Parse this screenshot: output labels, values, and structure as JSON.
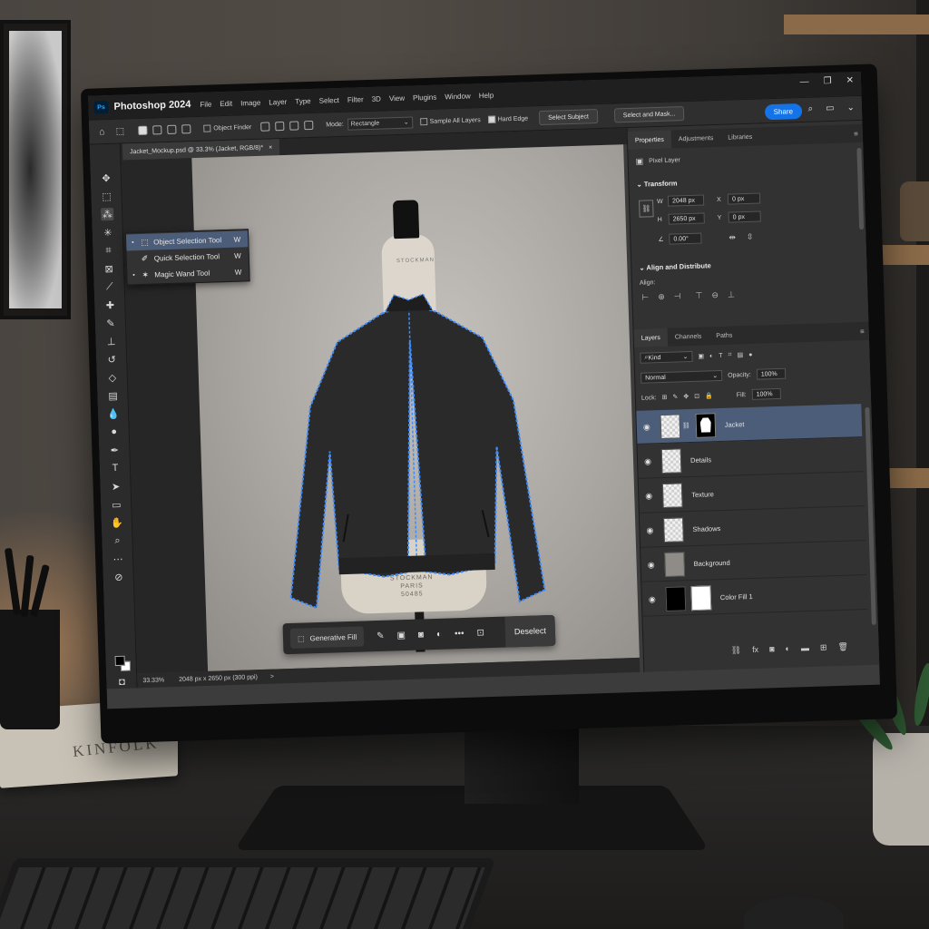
{
  "scene": {
    "book_title": "KINFOLK"
  },
  "titlebar": {
    "logo": "Ps",
    "app_name": "Photoshop 2024",
    "menu": [
      "File",
      "Edit",
      "Image",
      "Layer",
      "Type",
      "Select",
      "Filter",
      "3D",
      "View",
      "Plugins",
      "Window",
      "Help"
    ],
    "window_controls": [
      "—",
      "❐",
      "✕"
    ]
  },
  "options_bar": {
    "object_finder": "Object Finder",
    "mode_label": "Mode:",
    "mode_value": "Rectangle",
    "sample_all_layers": "Sample All Layers",
    "hard_edge": "Hard Edge",
    "select_subject": "Select Subject",
    "select_and_mask": "Select and Mask...",
    "share": "Share",
    "accent_color": "#1473e6"
  },
  "document_tab": {
    "title": "Jacket_Mockup.psd @ 33.3% (Jacket, RGB/8)*",
    "close": "×"
  },
  "tool_flyout": {
    "items": [
      {
        "label": "Object Selection Tool",
        "key": "W",
        "icon": "object-selection-icon",
        "selected": true
      },
      {
        "label": "Quick Selection Tool",
        "key": "W",
        "icon": "quick-selection-icon",
        "selected": false
      },
      {
        "label": "Magic Wand Tool",
        "key": "W",
        "icon": "magic-wand-icon",
        "selected": false
      }
    ]
  },
  "canvas": {
    "neck_label": "STOCKMAN",
    "form_label_1": "STOCKMAN",
    "form_label_2": "PARIS",
    "form_label_3": "50485"
  },
  "context_bar": {
    "generative_fill": "Generative Fill",
    "more": "•••",
    "deselect": "Deselect"
  },
  "status_bar": {
    "zoom": "33.33%",
    "doc_info": "2048 px x 2650 px (300 ppi)",
    "arrow": ">"
  },
  "properties_panel": {
    "tabs": [
      "Properties",
      "Adjustments",
      "Libraries"
    ],
    "layer_kind": "Pixel Layer",
    "transform_title": "Transform",
    "w_label": "W",
    "w_value": "2048 px",
    "h_label": "H",
    "h_value": "2650 px",
    "x_label": "X",
    "x_value": "0 px",
    "y_label": "Y",
    "y_value": "0 px",
    "angle_value": "0.00°",
    "align_title": "Align and Distribute",
    "align_label": "Align:"
  },
  "layers_panel": {
    "tabs": [
      "Layers",
      "Channels",
      "Paths"
    ],
    "filter_kind": "Kind",
    "blend_mode": "Normal",
    "opacity_label": "Opacity:",
    "opacity_value": "100%",
    "lock_label": "Lock:",
    "fill_label": "Fill:",
    "fill_value": "100%",
    "layers": [
      {
        "name": "Jacket",
        "selected": true
      },
      {
        "name": "Details",
        "selected": false
      },
      {
        "name": "Texture",
        "selected": false
      },
      {
        "name": "Shadows",
        "selected": false
      },
      {
        "name": "Background",
        "selected": false
      },
      {
        "name": "Color Fill 1",
        "selected": false
      }
    ],
    "selection_color": "#4c5d7a"
  }
}
